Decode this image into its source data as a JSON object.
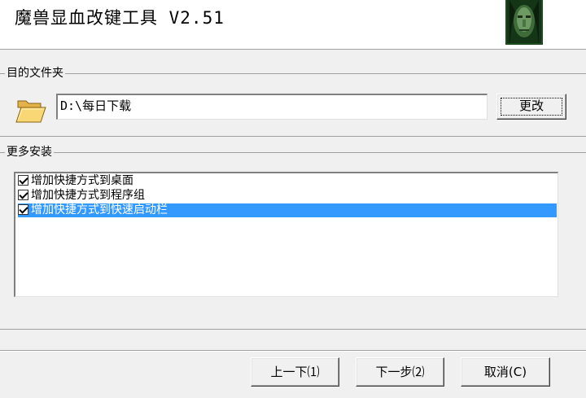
{
  "header": {
    "title": "魔兽显血改键工具 V2.51",
    "logo_icon": "warcraft-face-icon"
  },
  "destination": {
    "group_label": "目的文件夹",
    "folder_icon": "folder-open-icon",
    "path_value": "D:\\每日下载",
    "change_button": "更改"
  },
  "more_install": {
    "group_label": "更多安装",
    "items": [
      {
        "label": "增加快捷方式到桌面",
        "checked": true,
        "selected": false
      },
      {
        "label": "增加快捷方式到程序组",
        "checked": true,
        "selected": false
      },
      {
        "label": "增加快捷方式到快速启动栏",
        "checked": true,
        "selected": true
      }
    ]
  },
  "footer": {
    "back_button": "上一下⑴",
    "next_button": "下一步⑵",
    "cancel_button": "取消(C)"
  },
  "colors": {
    "selection": "#3399ff",
    "window_bg": "#f0f0f0"
  }
}
